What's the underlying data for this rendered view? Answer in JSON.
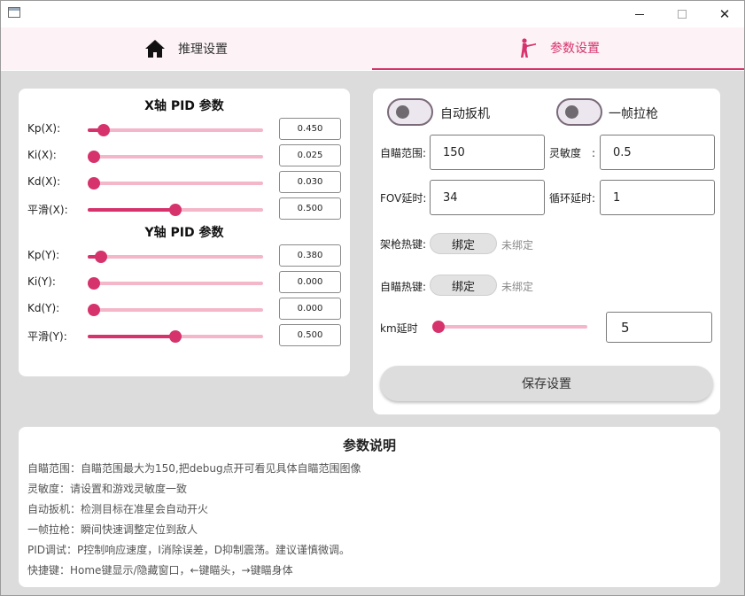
{
  "window": {
    "minimize_glyph": "",
    "maximize_glyph": "",
    "close_glyph": "✕"
  },
  "tabs": [
    {
      "label": "推理设置",
      "icon": "home-icon"
    },
    {
      "label": "参数设置",
      "icon": "rifleman-icon",
      "active": true
    }
  ],
  "accent_color": "#d6336c",
  "pid": {
    "x_title": "X轴 PID 参数",
    "y_title": "Y轴 PID 参数",
    "x_rows": [
      {
        "label": "Kp(X):",
        "value": "0.450",
        "level": 0.09
      },
      {
        "label": "Ki(X):",
        "value": "0.025",
        "level": 0.0
      },
      {
        "label": "Kd(X):",
        "value": "0.030",
        "level": 0.0
      },
      {
        "label": "平滑(X):",
        "value": "0.500",
        "level": 0.5
      }
    ],
    "y_rows": [
      {
        "label": "Kp(Y):",
        "value": "0.380",
        "level": 0.075
      },
      {
        "label": "Ki(Y):",
        "value": "0.000",
        "level": 0.0
      },
      {
        "label": "Kd(Y):",
        "value": "0.000",
        "level": 0.0
      },
      {
        "label": "平滑(Y):",
        "value": "0.500",
        "level": 0.5
      }
    ]
  },
  "settings": {
    "auto_trigger_label": "自动扳机",
    "auto_trigger_on": false,
    "one_frame_label": "一帧拉枪",
    "one_frame_on": false,
    "aim_range_label": "自瞄范围:",
    "aim_range_value": "150",
    "sensitivity_label": "灵敏度　:",
    "sensitivity_value": "0.5",
    "fov_delay_label": "FOV延时:",
    "fov_delay_value": "34",
    "loop_delay_label": "循环延时:",
    "loop_delay_value": "1",
    "gun_hotkey_label": "架枪热键:",
    "gun_hotkey_button": "绑定",
    "gun_hotkey_status": "未绑定",
    "aim_hotkey_label": "自瞄热键:",
    "aim_hotkey_button": "绑定",
    "aim_hotkey_status": "未绑定",
    "km_delay_label": "km延时",
    "km_delay_value": "5",
    "km_delay_level": 0.0,
    "save_label": "保存设置"
  },
  "description": {
    "title": "参数说明",
    "lines": [
      "自瞄范围：自瞄范围最大为150,把debug点开可看见具体自瞄范围图像",
      "灵敏度：请设置和游戏灵敏度一致",
      "自动扳机：检测目标在准星会自动开火",
      "一帧拉枪：瞬间快速调整定位到敌人",
      "PID调试：P控制响应速度，I消除误差，D抑制震荡。建议谨慎微调。",
      "快捷键：Home键显示/隐藏窗口，←键瞄头，→键瞄身体"
    ]
  }
}
